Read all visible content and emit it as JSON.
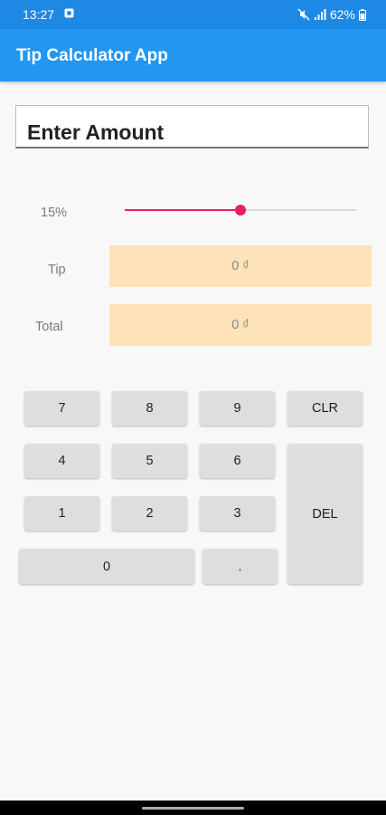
{
  "status": {
    "time": "13:27",
    "battery": "62%"
  },
  "app": {
    "title": "Tip Calculator App"
  },
  "amount": {
    "placeholder": "Enter Amount",
    "value": ""
  },
  "tip_percent": {
    "label": "15%",
    "slider_fraction": 0.5
  },
  "tip": {
    "label": "Tip",
    "value": "0 ₫"
  },
  "total": {
    "label": "Total",
    "value": "0 ₫"
  },
  "keypad": {
    "k7": "7",
    "k8": "8",
    "k9": "9",
    "clr": "CLR",
    "k4": "4",
    "k5": "5",
    "k6": "6",
    "del": "DEL",
    "k1": "1",
    "k2": "2",
    "k3": "3",
    "k0": "0",
    "dot": "."
  },
  "colors": {
    "app_bar": "#2196f3",
    "status_bar": "#1e88e5",
    "accent": "#e91e63",
    "result_bg": "#fee3b8"
  }
}
